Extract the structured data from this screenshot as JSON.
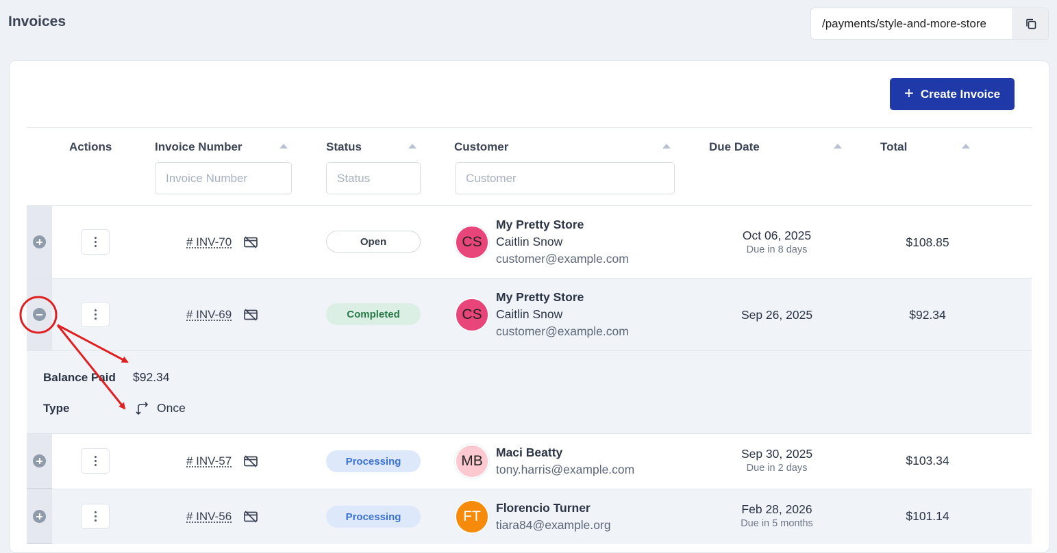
{
  "header": {
    "title": "Invoices",
    "url_path": "/payments/style-and-more-store"
  },
  "toolbar": {
    "create_label": "Create Invoice"
  },
  "table": {
    "columns": {
      "actions": "Actions",
      "invoice_number": "Invoice Number",
      "status": "Status",
      "customer": "Customer",
      "due_date": "Due Date",
      "total": "Total"
    },
    "filters": {
      "invoice_number_placeholder": "Invoice Number",
      "status_placeholder": "Status",
      "customer_placeholder": "Customer"
    },
    "rows": [
      {
        "invoice": "# INV-70",
        "status": "Open",
        "avatar_initials": "CS",
        "avatar_color": "#e8457a",
        "store": "My Pretty Store",
        "customer_name": "Caitlin Snow",
        "email": "customer@example.com",
        "due_date": "Oct 06, 2025",
        "due_relative": "Due in 8 days",
        "total": "$108.85"
      },
      {
        "invoice": "# INV-69",
        "status": "Completed",
        "avatar_initials": "CS",
        "avatar_color": "#e8457a",
        "store": "My Pretty Store",
        "customer_name": "Caitlin Snow",
        "email": "customer@example.com",
        "due_date": "Sep 26, 2025",
        "total": "$92.34",
        "details": {
          "balance_paid_label": "Balance Paid",
          "balance_paid_value": "$92.34",
          "type_label": "Type",
          "type_value": "Once"
        }
      },
      {
        "invoice": "# INV-57",
        "status": "Processing",
        "avatar_initials": "MB",
        "avatar_color": "#fbc9cf",
        "customer_name": "Maci Beatty",
        "email": "tony.harris@example.com",
        "due_date": "Sep 30, 2025",
        "due_relative": "Due in 2 days",
        "total": "$103.34"
      },
      {
        "invoice": "# INV-56",
        "status": "Processing",
        "avatar_initials": "FT",
        "avatar_color": "#f58a0b",
        "customer_name": "Florencio Turner",
        "email": "tiara84@example.org",
        "due_date": "Feb 28, 2026",
        "due_relative": "Due in 5 months",
        "total": "$101.14"
      }
    ]
  },
  "colors": {
    "primary": "#1f3aa8",
    "annotation": "#e02020"
  }
}
